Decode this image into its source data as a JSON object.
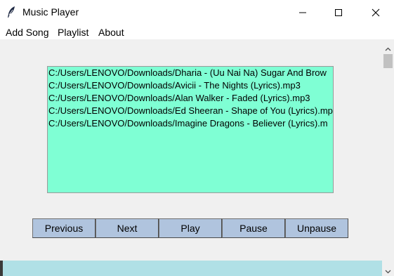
{
  "window": {
    "title": "Music Player",
    "app_icon": "feather-icon",
    "controls": [
      "minimize-icon",
      "maximize-icon",
      "close-icon"
    ]
  },
  "menu": {
    "items": [
      {
        "label": "Add Song"
      },
      {
        "label": "Playlist"
      },
      {
        "label": "About"
      }
    ]
  },
  "playlist": {
    "items": [
      "C:/Users/LENOVO/Downloads/Dharia - (Uu Nai Na) Sugar And Brow",
      "C:/Users/LENOVO/Downloads/Avicii - The Nights (Lyrics).mp3",
      "C:/Users/LENOVO/Downloads/Alan Walker - Faded (Lyrics).mp3",
      "C:/Users/LENOVO/Downloads/Ed Sheeran - Shape of You (Lyrics).mp",
      "C:/Users/LENOVO/Downloads/Imagine Dragons - Believer (Lyrics).m"
    ]
  },
  "controls": {
    "previous": "Previous",
    "next": "Next",
    "play": "Play",
    "pause": "Pause",
    "unpause": "Unpause"
  },
  "colors": {
    "playlist_bg": "#7fffd4",
    "button_bg": "#b0c4de",
    "bottom_strip": "#b0e0e6"
  }
}
